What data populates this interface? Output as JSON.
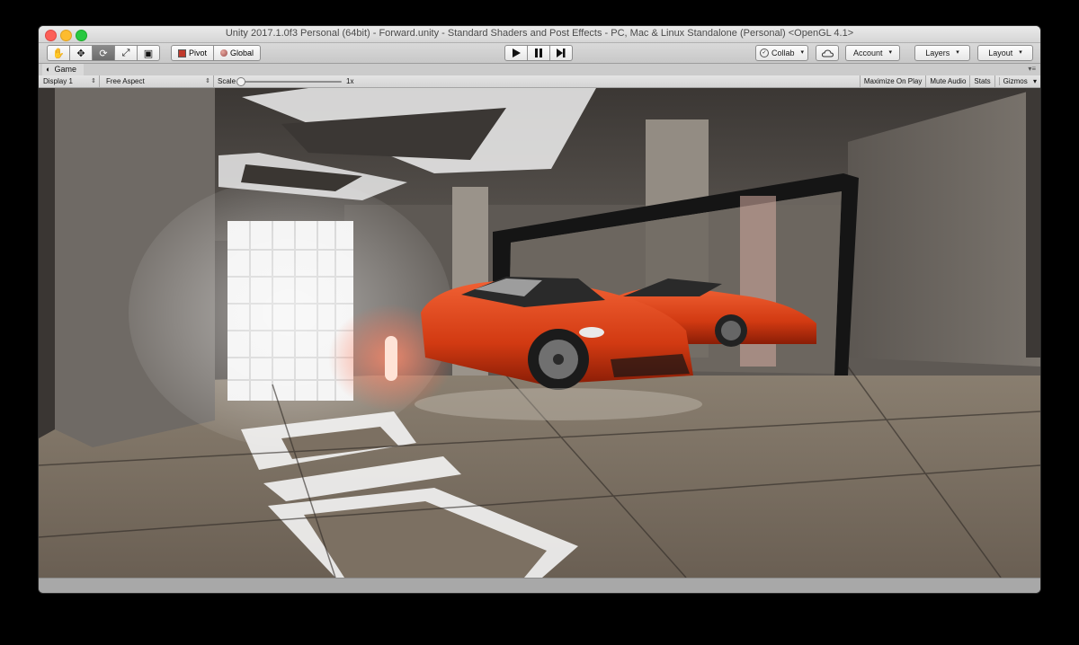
{
  "window": {
    "title": "Unity 2017.1.0f3 Personal (64bit) - Forward.unity - Standard Shaders and Post Effects - PC, Mac & Linux Standalone (Personal) <OpenGL 4.1>"
  },
  "toolbar": {
    "tools": [
      {
        "name": "hand-tool",
        "icon": "hand-icon",
        "glyph": "✋"
      },
      {
        "name": "move-tool",
        "icon": "move-icon",
        "glyph": "✥"
      },
      {
        "name": "rotate-tool",
        "icon": "rotate-icon",
        "glyph": "⟳"
      },
      {
        "name": "scale-tool",
        "icon": "scale-icon",
        "glyph": "⤢"
      },
      {
        "name": "rect-tool",
        "icon": "rect-tool-icon",
        "glyph": "▣"
      }
    ],
    "pivot_label": "Pivot",
    "global_label": "Global",
    "collab_label": "Collab",
    "account_label": "Account",
    "layers_label": "Layers",
    "layout_label": "Layout"
  },
  "game_view": {
    "tab_label": "Game",
    "display": "Display 1",
    "aspect": "Free Aspect",
    "scale_label": "Scale",
    "scale_value": "1x",
    "maximize_on_play": "Maximize On Play",
    "mute_audio": "Mute Audio",
    "stats": "Stats",
    "gizmos": "Gizmos"
  },
  "colors": {
    "car": "#d43a12",
    "floor": "#7f7466",
    "wall": "#6a6561"
  }
}
